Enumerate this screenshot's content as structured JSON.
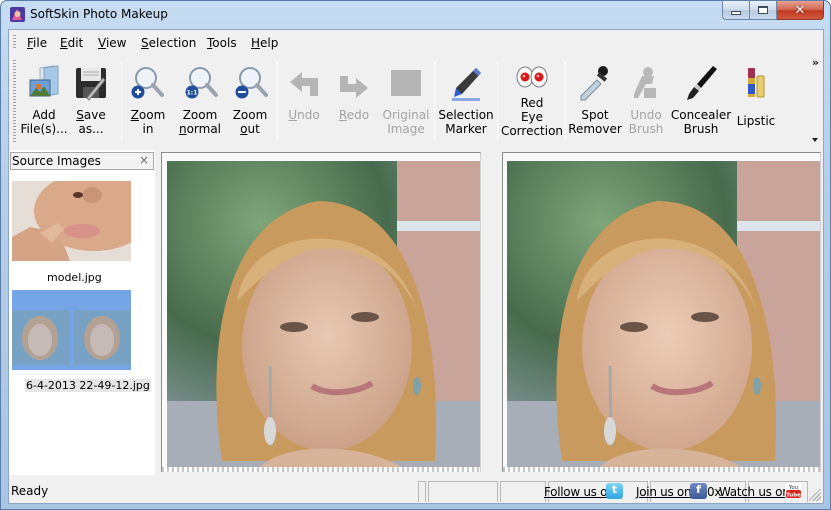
{
  "window": {
    "title": "SoftSkin Photo Makeup",
    "controls": {
      "minimize": "minimize",
      "maximize": "maximize",
      "close": "✕"
    }
  },
  "menu": [
    {
      "label": "File",
      "accel": "F",
      "rest": "ile"
    },
    {
      "label": "Edit",
      "accel": "E",
      "rest": "dit"
    },
    {
      "label": "View",
      "accel": "V",
      "rest": "iew"
    },
    {
      "label": "Selection",
      "accel": "S",
      "rest": "election"
    },
    {
      "label": "Tools",
      "accel": "T",
      "rest": "ools"
    },
    {
      "label": "Help",
      "accel": "H",
      "rest": "elp"
    }
  ],
  "toolbar": {
    "overflow": "»",
    "buttons": [
      {
        "id": "add-files",
        "line1": "Add",
        "line2": "File(s)...",
        "icon": "add-files-icon",
        "enabled": true
      },
      {
        "id": "save-as",
        "line1": "Save",
        "line2": "as...",
        "icon": "save-icon",
        "enabled": true
      },
      {
        "id": "zoom-in",
        "line1": "Zoom",
        "line2": "in",
        "icon": "zoom-in-icon",
        "enabled": true
      },
      {
        "id": "zoom-normal",
        "line1": "Zoom",
        "line2": "normal",
        "icon": "zoom-normal-icon",
        "badge": "1:1",
        "enabled": true
      },
      {
        "id": "zoom-out",
        "line1": "Zoom",
        "line2": "out",
        "icon": "zoom-out-icon",
        "enabled": true
      },
      {
        "id": "undo",
        "line1": "Undo",
        "line2": "",
        "icon": "undo-icon",
        "enabled": false
      },
      {
        "id": "redo",
        "line1": "Redo",
        "line2": "",
        "icon": "redo-icon",
        "enabled": false
      },
      {
        "id": "original-image",
        "line1": "Original",
        "line2": "Image",
        "icon": "original-image-icon",
        "enabled": false
      },
      {
        "id": "selection-marker",
        "line1": "Selection",
        "line2": "Marker",
        "icon": "marker-icon",
        "enabled": true
      },
      {
        "id": "red-eye",
        "line1": "Red",
        "line2": "Eye",
        "line3": "Correction",
        "icon": "red-eye-icon",
        "enabled": true
      },
      {
        "id": "spot-remover",
        "line1": "Spot",
        "line2": "Remover",
        "icon": "dropper-icon",
        "enabled": true
      },
      {
        "id": "undo-brush",
        "line1": "Undo",
        "line2": "Brush",
        "icon": "undo-brush-icon",
        "enabled": false
      },
      {
        "id": "concealer-brush",
        "line1": "Concealer",
        "line2": "Brush",
        "icon": "brush-icon",
        "enabled": true
      },
      {
        "id": "lipstic",
        "line1": "Lipstic",
        "line2": "",
        "icon": "lipstick-icon",
        "enabled": true
      }
    ]
  },
  "source_panel": {
    "title": "Source Images",
    "close": "×",
    "images": [
      {
        "name": "model.jpg",
        "selected": false
      },
      {
        "name": "6-4-2013 22-49-12.jpg",
        "selected": true
      }
    ]
  },
  "views": {
    "left": "original-photo",
    "right": "processed-photo"
  },
  "statusbar": {
    "status": "Ready",
    "twitter_link": "Follow us on",
    "twitter_glyph": "t",
    "facebook_link": "Join us on",
    "facebook_glyph": "f",
    "facebook_suffix": "0x",
    "youtube_link": "Watch us on",
    "youtube_top": "You",
    "youtube_bottom": "Tube"
  },
  "colors": {
    "frame": "#b4cde8",
    "close_button": "#c23a22",
    "client_bg": "#f0f0f0",
    "disabled_text": "#a3a3a3"
  }
}
